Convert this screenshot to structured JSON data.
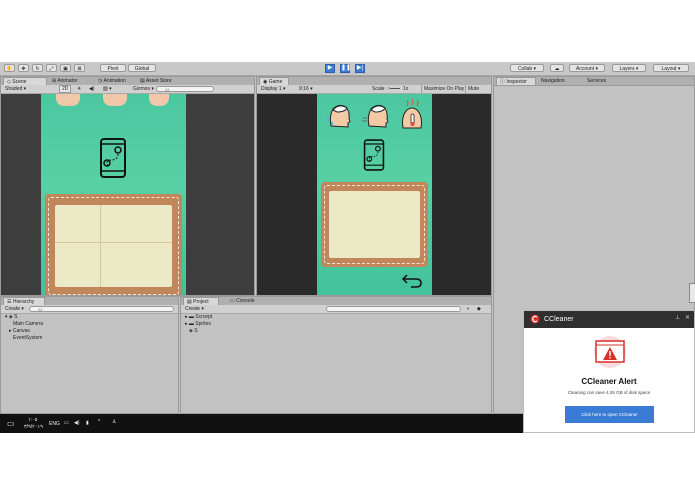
{
  "toolbar": {
    "pivot_label": "Pivot",
    "global_label": "Global",
    "collab_label": "Collab",
    "account_label": "Account",
    "layers_label": "Layers",
    "layout_label": "Layout"
  },
  "scene_panel": {
    "tabs": [
      "Scene",
      "Animator",
      "Animation",
      "Asset Store"
    ],
    "shaded_label": "Shaded",
    "mode_2d_label": "2D",
    "gizmos_label": "Gizmos",
    "search_placeholder": "All"
  },
  "game_panel": {
    "tab_label": "Game",
    "display_label": "Display 1",
    "aspect_label": "9:16",
    "scale_label": "Scale",
    "scale_value": "1x",
    "maximize_label": "Maximize On Play",
    "mute_label": "Mute Audio"
  },
  "inspector_panel": {
    "tabs": [
      "Inspector",
      "Navigation",
      "Services"
    ]
  },
  "hierarchy_panel": {
    "tab_label": "Hierarchy",
    "create_label": "Create",
    "search_placeholder": "All",
    "scene_name": "S",
    "items": [
      "Main Camera",
      "Canvas",
      "EventSystem"
    ]
  },
  "project_panel": {
    "tabs": [
      "Project",
      "Console"
    ],
    "create_label": "Create",
    "items": [
      "Scrcept",
      "Sprites",
      "S"
    ]
  },
  "taskbar": {
    "clock_time": "١:٠٥",
    "clock_date": "٣/٩/٢٠١٩",
    "language": "ENG"
  },
  "ccleaner": {
    "app_name": "CCleaner",
    "title": "CCleaner Alert",
    "message": "Cleaning can save 4.26 GB of disk space",
    "button_label": "Click here to open CCleaner",
    "accent": "#3a7bd5",
    "alert_color": "#d9302c"
  }
}
